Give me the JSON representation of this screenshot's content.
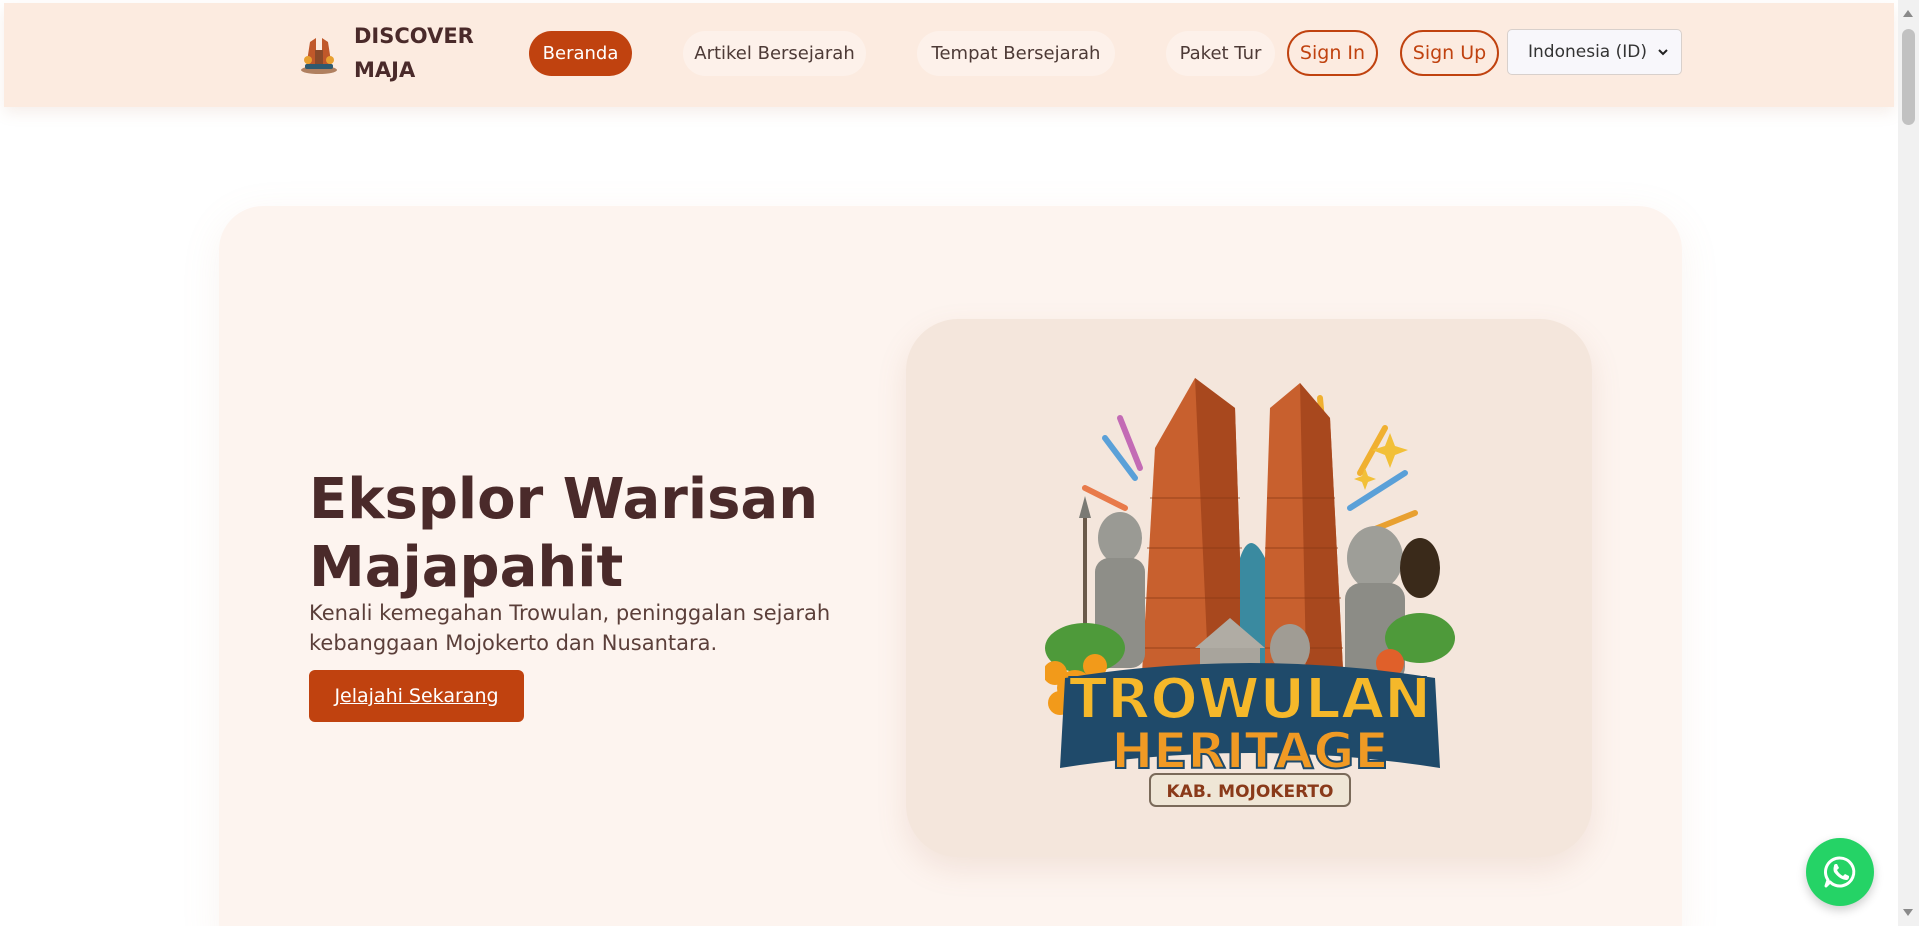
{
  "brand": {
    "name": "DISCOVER MAJA",
    "logo_icon": "temple-logo-icon"
  },
  "nav": {
    "items": [
      {
        "label": "Beranda",
        "active": true
      },
      {
        "label": "Artikel Bersejarah",
        "active": false
      },
      {
        "label": "Tempat Bersejarah",
        "active": false
      },
      {
        "label": "Paket Tur",
        "active": false
      }
    ],
    "sign_in": "Sign In",
    "sign_up": "Sign Up",
    "language": {
      "selected": "Indonesia (ID)"
    }
  },
  "hero": {
    "title": "Eksplor Warisan Majapahit",
    "subtitle": "Kenali kemegahan Trowulan, peninggalan sejarah kebanggaan Mojokerto dan Nusantara.",
    "cta": "Jelajahi Sekarang",
    "image": {
      "line1": "TROWULAN",
      "line2": "HERITAGE",
      "badge": "KAB. MOJOKERTO"
    }
  },
  "floating": {
    "whatsapp_icon": "whatsapp-icon"
  },
  "colors": {
    "accent": "#c0420f",
    "nav_bg": "#fcebe0",
    "hero_bg": "#fdf4ef",
    "image_bg": "#f4e6dc",
    "text_dark": "#4a2a2a",
    "whatsapp": "#25d366"
  }
}
